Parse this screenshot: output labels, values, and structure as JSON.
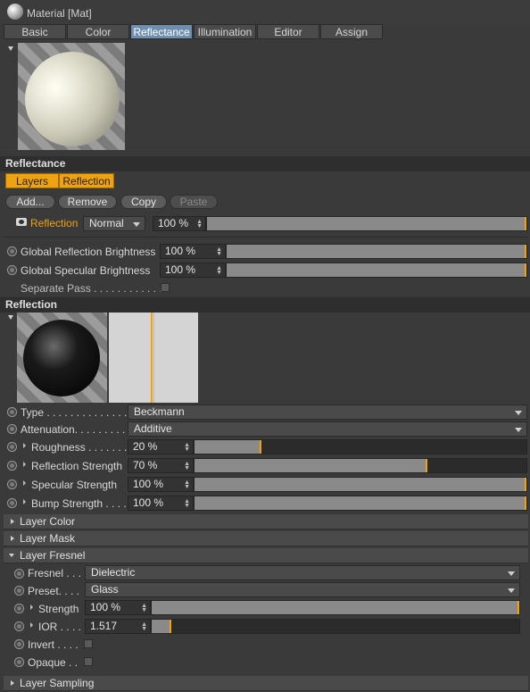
{
  "window": {
    "title": "Material [Mat]"
  },
  "tabs": [
    "Basic",
    "Color",
    "Reflectance",
    "Illumination",
    "Editor",
    "Assign"
  ],
  "active_tab": "Reflectance",
  "reflectance_section": {
    "heading": "Reflectance",
    "layer_tabs": [
      "Layers",
      "Reflection"
    ],
    "buttons": {
      "add": "Add...",
      "remove": "Remove",
      "copy": "Copy",
      "paste": "Paste"
    },
    "layer_row": {
      "name": "Reflection",
      "blend_mode": "Normal",
      "opacity": "100 %",
      "opacity_value": 1.0
    },
    "global_reflection_label": "Global Reflection Brightness",
    "global_reflection_value": "100 %",
    "global_reflection_level": 1.0,
    "global_specular_label": "Global Specular Brightness",
    "global_specular_value": "100 %",
    "global_specular_level": 1.0,
    "separate_pass_label": "Separate Pass . . . . . . . . . . . . .",
    "separate_pass_checked": false
  },
  "reflection_section": {
    "heading": "Reflection",
    "type_label": "Type . . . . . . . . . . . . . . .",
    "type_value": "Beckmann",
    "attenuation_label": "Attenuation. . . . . . . . . .",
    "attenuation_value": "Additive",
    "roughness_label": "Roughness . . . . . . .",
    "roughness_value": "20 %",
    "roughness_level": 0.2,
    "reflection_strength_label": "Reflection Strength",
    "reflection_strength_value": "70 %",
    "reflection_strength_level": 0.7,
    "specular_strength_label": "Specular Strength",
    "specular_strength_value": "100 %",
    "specular_strength_level": 1.0,
    "bump_strength_label": "Bump Strength . . . .",
    "bump_strength_value": "100 %",
    "bump_strength_level": 1.0
  },
  "collapsed_groups": {
    "layer_color": "Layer Color",
    "layer_mask": "Layer Mask",
    "layer_sampling": "Layer Sampling"
  },
  "layer_fresnel": {
    "heading": "Layer Fresnel",
    "fresnel_label": "Fresnel . . .",
    "fresnel_value": "Dielectric",
    "preset_label": "Preset. . . .",
    "preset_value": "Glass",
    "strength_label": "Strength",
    "strength_value": "100 %",
    "strength_level": 1.0,
    "ior_label": "IOR . . . .",
    "ior_value": "1.517",
    "ior_level": 0.05,
    "invert_label": "Invert . . . .",
    "invert_checked": false,
    "opaque_label": "Opaque . .",
    "opaque_checked": false
  },
  "colors": {
    "accent": "#f0a310",
    "active_tab": "#6f8fb0",
    "background": "#3a3a3a"
  },
  "icons": [
    "material-sphere-icon",
    "eye-icon",
    "radio-icon",
    "dropdown-arrow-icon",
    "expand-arrow-icon"
  ]
}
